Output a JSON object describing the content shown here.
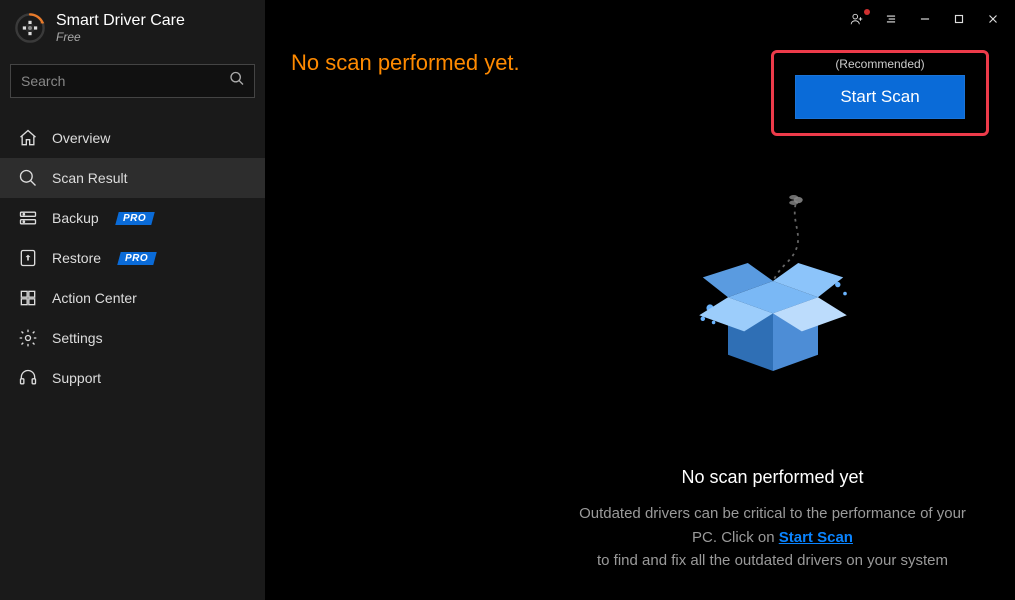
{
  "colors": {
    "accent": "#0a6bd8",
    "highlight": "#ed3b4a",
    "warning_text": "#ff8a00",
    "link": "#0a84ff"
  },
  "app": {
    "title": "Smart Driver Care",
    "edition": "Free"
  },
  "search": {
    "placeholder": "Search"
  },
  "nav": {
    "overview": "Overview",
    "scan_result": "Scan Result",
    "backup": "Backup",
    "restore": "Restore",
    "action_center": "Action Center",
    "settings": "Settings",
    "support": "Support",
    "pro_badge": "PRO"
  },
  "status": {
    "headline": "No scan performed yet."
  },
  "scan": {
    "recommended_label": "(Recommended)",
    "button_label": "Start Scan"
  },
  "caption": {
    "title": "No scan performed yet",
    "line1_pre": "Outdated drivers can be critical to the performance of your PC. Click on ",
    "link": "Start Scan",
    "line2": "to find and fix all the outdated drivers on your system"
  }
}
